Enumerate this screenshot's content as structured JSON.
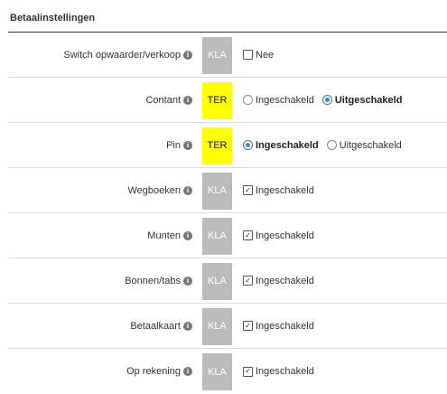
{
  "section": {
    "title": "Betaalinstellingen"
  },
  "info_icon_glyph": "i",
  "rows": [
    {
      "label": "Switch opwaarder/verkoop",
      "badge": "KLA",
      "badge_type": "kla",
      "control": "checkbox",
      "checked": false,
      "option": "Nee"
    },
    {
      "label": "Contant",
      "badge": "TER",
      "badge_type": "ter",
      "control": "radio",
      "options": [
        "Ingeschakeld",
        "Uitgeschakeld"
      ],
      "selected": 1
    },
    {
      "label": "Pin",
      "badge": "TER",
      "badge_type": "ter",
      "control": "radio",
      "options": [
        "Ingeschakeld",
        "Uitgeschakeld"
      ],
      "selected": 0
    },
    {
      "label": "Wegboeken",
      "badge": "KLA",
      "badge_type": "kla",
      "control": "checkbox",
      "checked": true,
      "option": "Ingeschakeld"
    },
    {
      "label": "Munten",
      "badge": "KLA",
      "badge_type": "kla",
      "control": "checkbox",
      "checked": true,
      "option": "Ingeschakeld"
    },
    {
      "label": "Bonnen/tabs",
      "badge": "KLA",
      "badge_type": "kla",
      "control": "checkbox",
      "checked": true,
      "option": "Ingeschakeld"
    },
    {
      "label": "Betaalkaart",
      "badge": "KLA",
      "badge_type": "kla",
      "control": "checkbox",
      "checked": true,
      "option": "Ingeschakeld"
    },
    {
      "label": "Op rekening",
      "badge": "KLA",
      "badge_type": "kla",
      "control": "checkbox",
      "checked": true,
      "option": "Ingeschakeld"
    }
  ]
}
